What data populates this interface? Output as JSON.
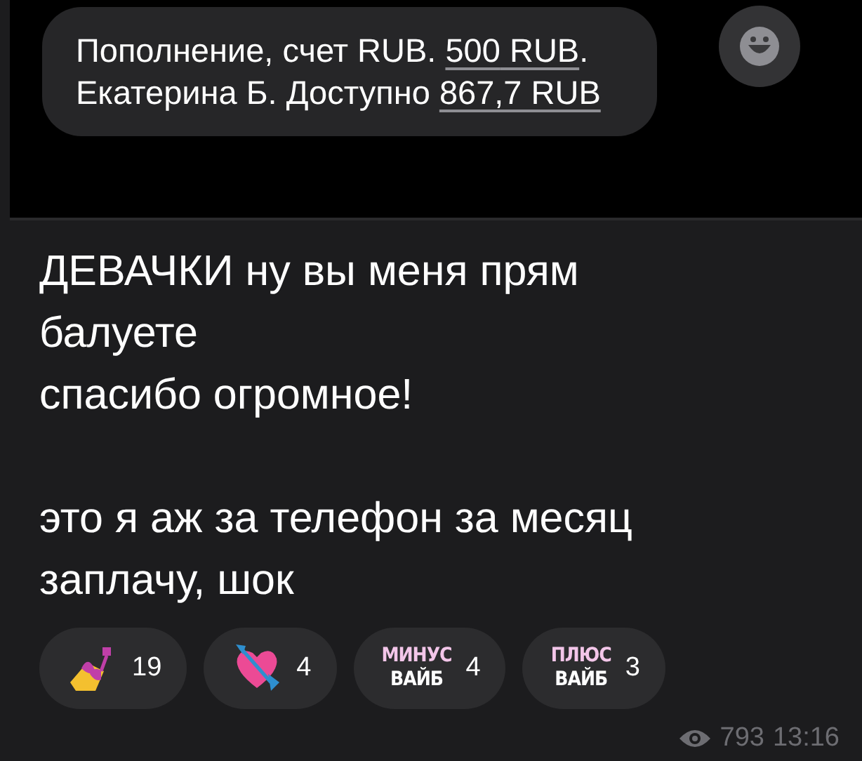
{
  "photo": {
    "bubble": [
      {
        "text": "Пополнение, счет RUB. ",
        "link": false
      },
      {
        "text": "500",
        "link": true
      },
      {
        "text": " RUB",
        "link": true
      },
      {
        "text": ". Екатерина Б. Доступно ",
        "link": false
      },
      {
        "text": "867,7 RUB",
        "link": true
      }
    ]
  },
  "post": {
    "text": "ДЕВАЧКИ ну вы меня прям балуете\nспасибо огромное!\n\nэто я аж за телефон за месяц заплачу, шок"
  },
  "reactions": [
    {
      "kind": "nail-polish",
      "count": "19"
    },
    {
      "kind": "heart-arrow",
      "count": "4"
    },
    {
      "kind": "sticker",
      "top": "МИНУС",
      "bottom": "ВАЙБ",
      "count": "4"
    },
    {
      "kind": "sticker",
      "top": "ПЛЮС",
      "bottom": "ВАЙБ",
      "count": "3"
    }
  ],
  "footer": {
    "views": "793",
    "time": "13:16"
  }
}
